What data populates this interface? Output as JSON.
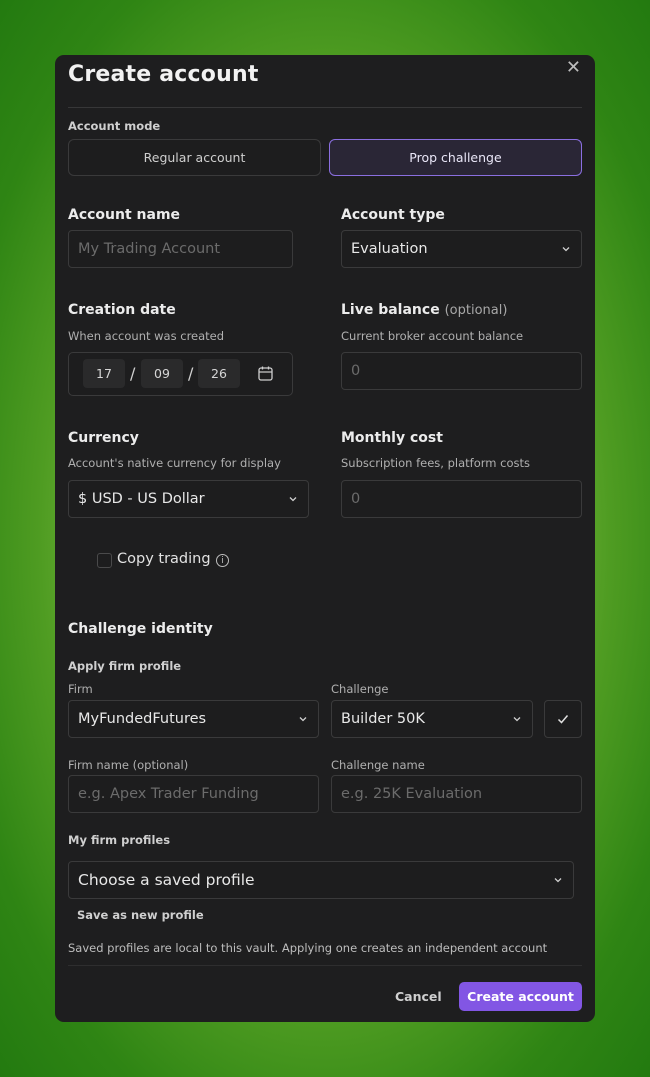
{
  "dialog": {
    "title": "Create account"
  },
  "mode": {
    "label": "Account mode",
    "regular": "Regular account",
    "prop": "Prop challenge"
  },
  "account_name": {
    "label": "Account name",
    "placeholder": "My Trading Account"
  },
  "account_type": {
    "label": "Account type",
    "value": "Evaluation"
  },
  "creation_date": {
    "label": "Creation date",
    "hint": "When account was created",
    "day": "17",
    "month": "09",
    "year": "26"
  },
  "live_balance": {
    "label": "Live balance",
    "optional": "(optional)",
    "hint": "Current broker account balance",
    "placeholder": "0"
  },
  "currency": {
    "label": "Currency",
    "hint": "Account's native currency for display",
    "value": "$ USD - US Dollar"
  },
  "monthly_cost": {
    "label": "Monthly cost",
    "hint": "Subscription fees, platform costs",
    "placeholder": "0"
  },
  "copy_trading": {
    "label": "Copy trading",
    "info_icon": "i"
  },
  "challenge_identity": {
    "heading": "Challenge identity",
    "apply_label": "Apply firm profile",
    "firm_label": "Firm",
    "firm_value": "MyFundedFutures",
    "challenge_label": "Challenge",
    "challenge_value": "Builder 50K",
    "firm_name_label": "Firm name (optional)",
    "firm_name_placeholder": "e.g. Apex Trader Funding",
    "challenge_name_label": "Challenge name",
    "challenge_name_placeholder": "e.g. 25K Evaluation"
  },
  "profiles": {
    "label": "My firm profiles",
    "select_value": "Choose a saved profile",
    "save_new": "Save as new profile",
    "note": "Saved profiles are local to this vault. Applying one creates an independent account snapshot; saving a new revision never changes existing accounts."
  },
  "footer": {
    "cancel": "Cancel",
    "create": "Create account"
  },
  "colors": {
    "accent": "#8256e4",
    "active_border": "#8b6fe0",
    "panel": "#1e1e1f"
  }
}
